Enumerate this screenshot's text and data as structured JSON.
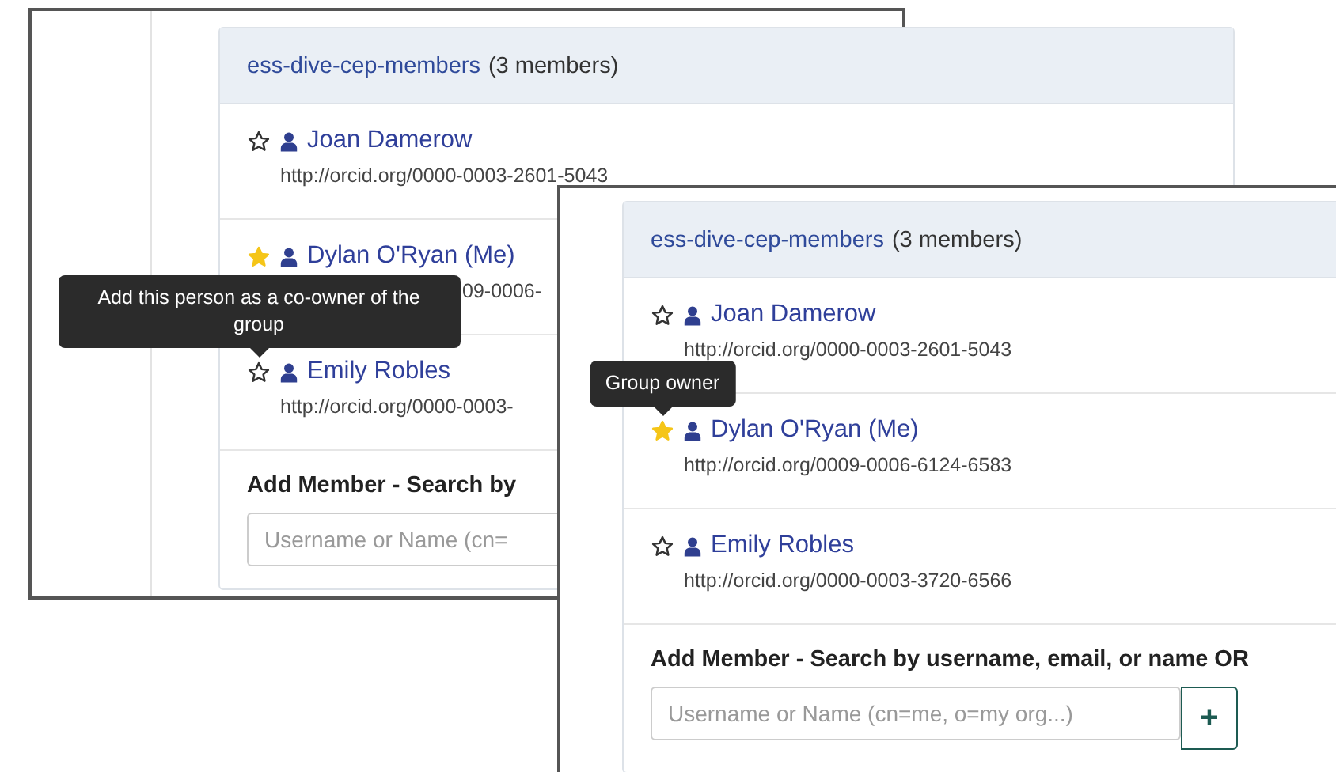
{
  "screenshots": [
    {
      "group": {
        "name": "ess-dive-cep-members",
        "count": "(3 members)"
      },
      "members": [
        {
          "name": "Joan Damerow",
          "url": "http://orcid.org/0000-0003-2601-5043",
          "owner": false
        },
        {
          "name": "Dylan O'Ryan (Me)",
          "url": "09-0006-",
          "owner": true
        },
        {
          "name": "Emily Robles",
          "url": "http://orcid.org/0000-0003-",
          "owner": false,
          "tooltip": "Add this person as a co-owner of the group"
        }
      ],
      "add_member": {
        "label": "Add Member - Search by",
        "placeholder": "Username or Name (cn="
      }
    },
    {
      "group": {
        "name": "ess-dive-cep-members",
        "count": "(3 members)"
      },
      "members": [
        {
          "name": "Joan Damerow",
          "url": "http://orcid.org/0000-0003-2601-5043",
          "owner": false
        },
        {
          "name": "Dylan O'Ryan (Me)",
          "url": "http://orcid.org/0009-0006-6124-6583",
          "owner": true,
          "tooltip": "Group owner"
        },
        {
          "name": "Emily Robles",
          "url": "http://orcid.org/0000-0003-3720-6566",
          "owner": false
        }
      ],
      "add_member": {
        "label": "Add Member - Search by username, email, or name OR",
        "placeholder": "Username or Name (cn=me, o=my org...)",
        "button": "+"
      }
    }
  ]
}
